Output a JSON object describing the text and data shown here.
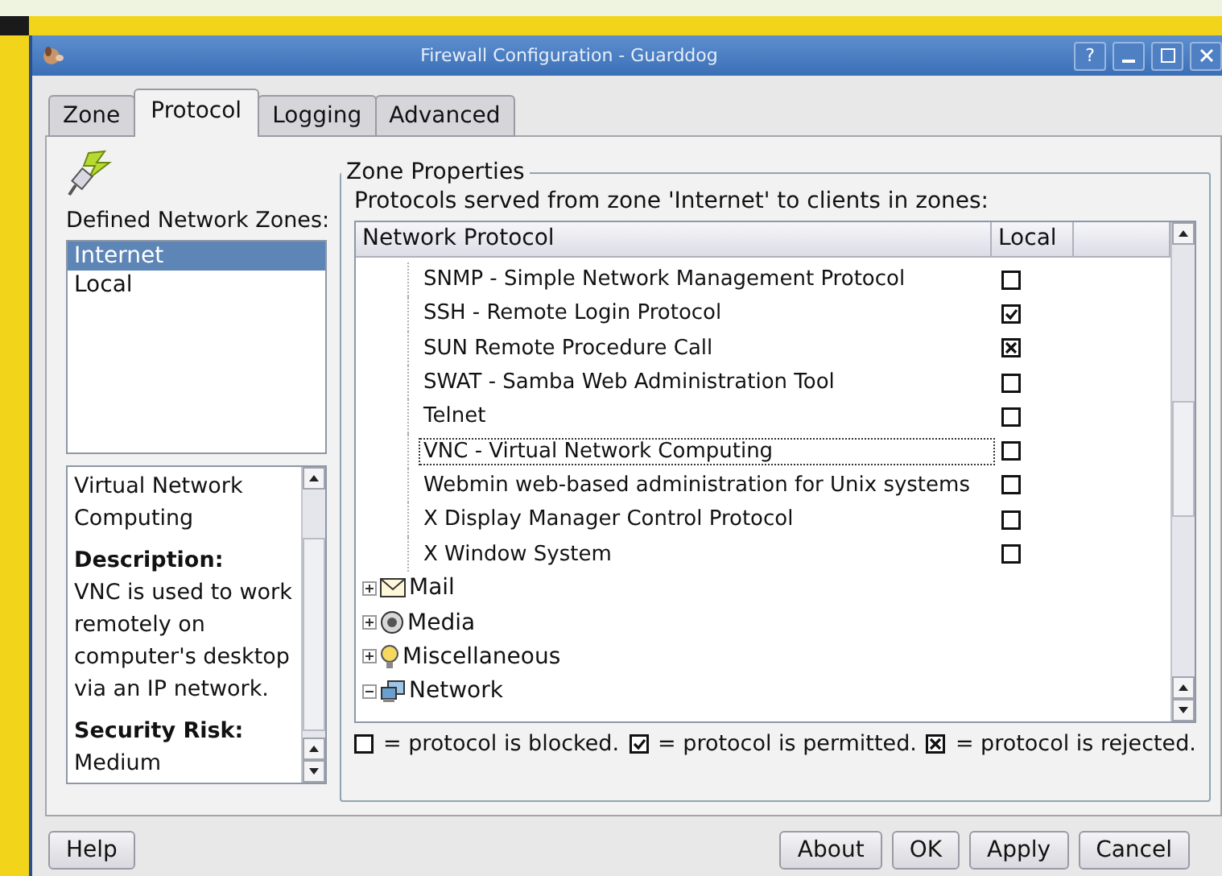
{
  "window": {
    "title": "Firewall Configuration - Guarddog",
    "title_buttons": [
      "?"
    ]
  },
  "tabs": [
    {
      "label": "Zone",
      "selected": false
    },
    {
      "label": "Protocol",
      "selected": true
    },
    {
      "label": "Logging",
      "selected": false
    },
    {
      "label": "Advanced",
      "selected": false
    }
  ],
  "zones": {
    "label": "Defined Network Zones:",
    "items": [
      {
        "label": "Internet",
        "selected": true
      },
      {
        "label": "Local",
        "selected": false
      }
    ]
  },
  "details": {
    "title": "Virtual Network Computing",
    "description_label": "Description:",
    "description": "VNC is used to work remotely on computer's desktop via an IP network.",
    "risk_label": "Security Risk:",
    "risk": "Medium"
  },
  "zone_properties": {
    "title": "Zone Properties",
    "caption": "Protocols served from zone 'Internet' to clients in zones:",
    "columns": [
      "Network Protocol",
      "Local"
    ],
    "protocols": [
      {
        "name": "SNMP - Simple Network Management Protocol",
        "checked": false,
        "crossed": false,
        "focused": false
      },
      {
        "name": "SSH - Remote Login Protocol",
        "checked": true,
        "crossed": false,
        "focused": false
      },
      {
        "name": "SUN Remote Procedure Call",
        "checked": false,
        "crossed": true,
        "focused": false
      },
      {
        "name": "SWAT - Samba Web Administration Tool",
        "checked": false,
        "crossed": false,
        "focused": false
      },
      {
        "name": "Telnet",
        "checked": false,
        "crossed": false,
        "focused": false
      },
      {
        "name": "VNC - Virtual Network Computing",
        "checked": false,
        "crossed": false,
        "focused": true
      },
      {
        "name": "Webmin web-based administration for Unix systems",
        "checked": false,
        "crossed": false,
        "focused": false
      },
      {
        "name": "X Display Manager Control Protocol",
        "checked": false,
        "crossed": false,
        "focused": false
      },
      {
        "name": "X Window System",
        "checked": false,
        "crossed": false,
        "focused": false
      }
    ],
    "categories": [
      {
        "name": "Mail",
        "kind": "mail",
        "expanded": false
      },
      {
        "name": "Media",
        "kind": "media",
        "expanded": false
      },
      {
        "name": "Miscellaneous",
        "kind": "misc",
        "expanded": false
      },
      {
        "name": "Network",
        "kind": "network",
        "expanded": true
      }
    ],
    "legend": [
      {
        "checked": false,
        "crossed": false,
        "text": "= protocol is blocked."
      },
      {
        "checked": true,
        "crossed": false,
        "text": "= protocol is permitted."
      },
      {
        "checked": false,
        "crossed": true,
        "text": "= protocol is rejected."
      }
    ]
  },
  "buttons_left": [
    "Help"
  ],
  "buttons_right": [
    "About",
    "OK",
    "Apply",
    "Cancel"
  ]
}
